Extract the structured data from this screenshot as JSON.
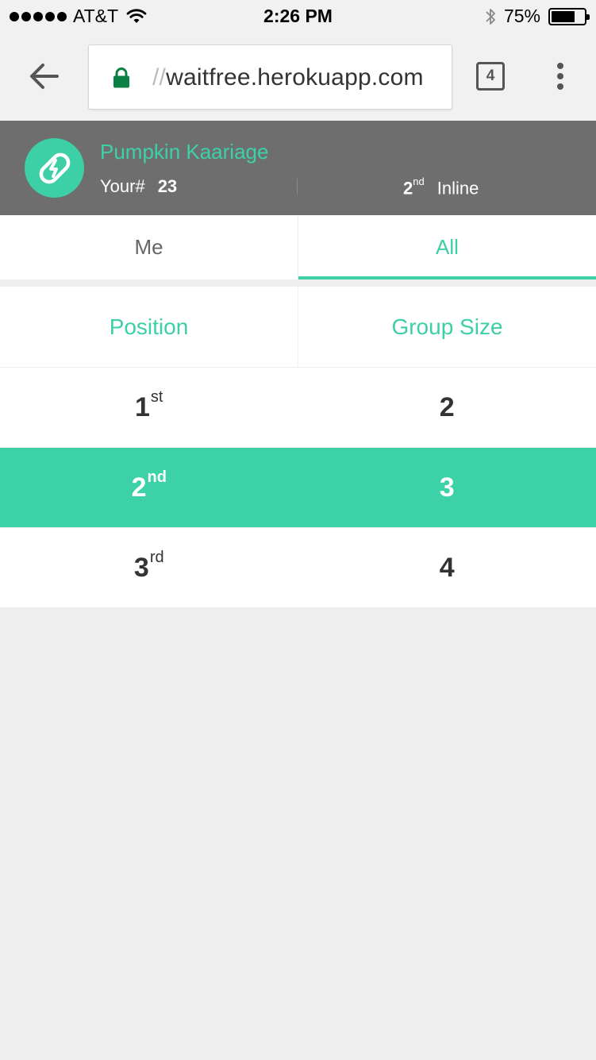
{
  "status_bar": {
    "carrier": "AT&T",
    "time": "2:26 PM",
    "battery_percent": "75%",
    "battery_level": 0.75,
    "icons": [
      "signal-dots-icon",
      "wifi-icon",
      "bluetooth-icon",
      "battery-icon"
    ]
  },
  "browser": {
    "url_scheme_fragment": "//",
    "url_host": "waitfree.herokuapp.com",
    "tab_count": "4",
    "icons": [
      "back-arrow-icon",
      "lock-icon",
      "tabs-icon",
      "more-vert-icon"
    ]
  },
  "header": {
    "party_name": "Pumpkin Kaariage",
    "your_number_label": "Your#",
    "your_number": "23",
    "position_number": "2",
    "position_suffix": "nd",
    "position_label": "Inline",
    "logo_icon": "link-icon"
  },
  "tabs": [
    {
      "label": "Me",
      "active": false
    },
    {
      "label": "All",
      "active": true
    }
  ],
  "table": {
    "columns": [
      "Position",
      "Group Size"
    ],
    "rows": [
      {
        "position": "1",
        "suffix": "st",
        "group_size": "2",
        "highlighted": false
      },
      {
        "position": "2",
        "suffix": "nd",
        "group_size": "3",
        "highlighted": true
      },
      {
        "position": "3",
        "suffix": "rd",
        "group_size": "4",
        "highlighted": false
      }
    ]
  },
  "colors": {
    "accent": "#3dcfa6",
    "header_bg": "#6e6e6e",
    "page_bg": "#efefef",
    "lock_green": "#0b8043"
  }
}
